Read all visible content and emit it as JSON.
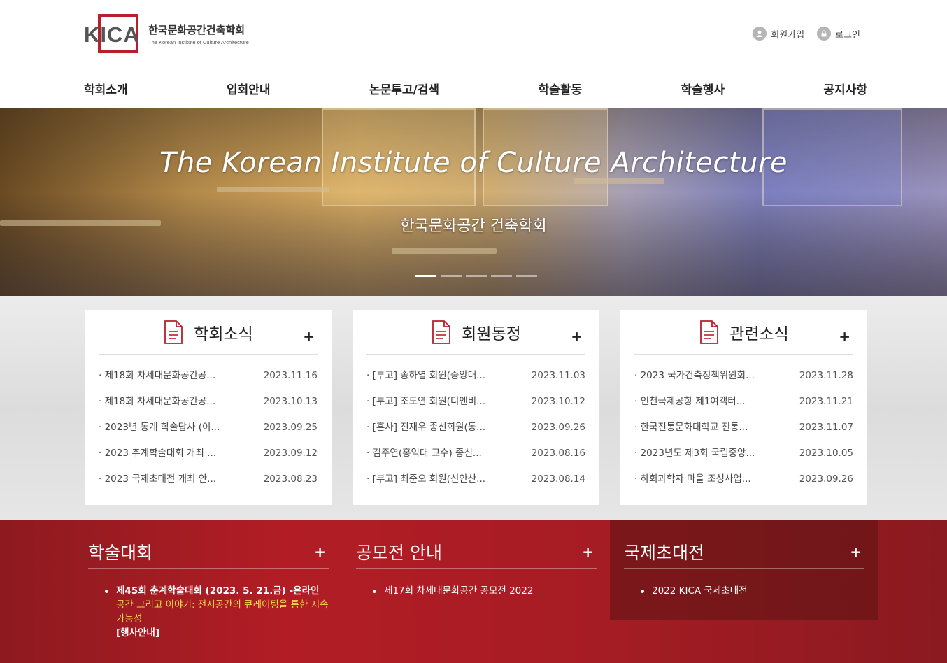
{
  "header": {
    "logo_letters": "KICA",
    "logo_ko": "한국문화공간건축학회",
    "logo_en": "The Korean Institute of Culture Architecture",
    "signup_label": "회원가입",
    "login_label": "로그인"
  },
  "nav": {
    "items": [
      "학회소개",
      "입회안내",
      "논문투고/검색",
      "학술활동",
      "학술행사",
      "공지사항"
    ]
  },
  "hero": {
    "title": "The Korean Institute of Culture Architecture",
    "subtitle": "한국문화공간 건축학회",
    "slide_count": 5,
    "active_slide": 1
  },
  "panels": [
    {
      "title": "학회소식",
      "plus": "+",
      "items": [
        {
          "title": "· 제18회 차세대문화공간공...",
          "date": "2023.11.16"
        },
        {
          "title": "· 제18회 차세대문화공간공...",
          "date": "2023.10.13"
        },
        {
          "title": "· 2023년 동계 학술답사 (이...",
          "date": "2023.09.25"
        },
        {
          "title": "· 2023 추계학술대회 개최 ...",
          "date": "2023.09.12"
        },
        {
          "title": "· 2023 국제초대전 개최 안...",
          "date": "2023.08.23"
        }
      ]
    },
    {
      "title": "회원동정",
      "plus": "+",
      "items": [
        {
          "title": "· [부고] 송하엽 회원(중앙대...",
          "date": "2023.11.03"
        },
        {
          "title": "· [부고] 조도연 회원(디엔비...",
          "date": "2023.10.12"
        },
        {
          "title": "· [혼사] 전재우 종신회원(동...",
          "date": "2023.09.26"
        },
        {
          "title": "· 김주연(홍익대 교수) 종신...",
          "date": "2023.08.16"
        },
        {
          "title": "· [부고] 최준오 회원(신안산...",
          "date": "2023.08.14"
        }
      ]
    },
    {
      "title": "관련소식",
      "plus": "+",
      "items": [
        {
          "title": "· 2023 국가건축정책위원회...",
          "date": "2023.11.28"
        },
        {
          "title": "· 인천국제공항 제1여객터...",
          "date": "2023.11.21"
        },
        {
          "title": "· 한국전통문화대학교 전통...",
          "date": "2023.11.07"
        },
        {
          "title": "· 2023년도 제3회 국립중앙...",
          "date": "2023.10.05"
        },
        {
          "title": "· 하회과학자 마을 조성사업...",
          "date": "2023.09.26"
        }
      ]
    }
  ],
  "bottom": {
    "conference": {
      "title": "학술대회",
      "plus": "+",
      "item_title": "제45회 춘계학술대회 (2023. 5. 21.금) -온라인",
      "item_theme": "공간 그리고 이야기: 전시공간의 큐레이팅을 통한 지속 가능성",
      "item_link": "[행사안내]"
    },
    "competition": {
      "title": "공모전 안내",
      "plus": "+",
      "item": "제17회 차세대문화공간 공모전 2022"
    },
    "exhibition": {
      "title": "국제초대전",
      "plus": "+",
      "item": "2022 KICA 국제초대전"
    }
  },
  "colors": {
    "brand_red": "#b61f2b",
    "theme_yellow": "#f5d94f"
  }
}
